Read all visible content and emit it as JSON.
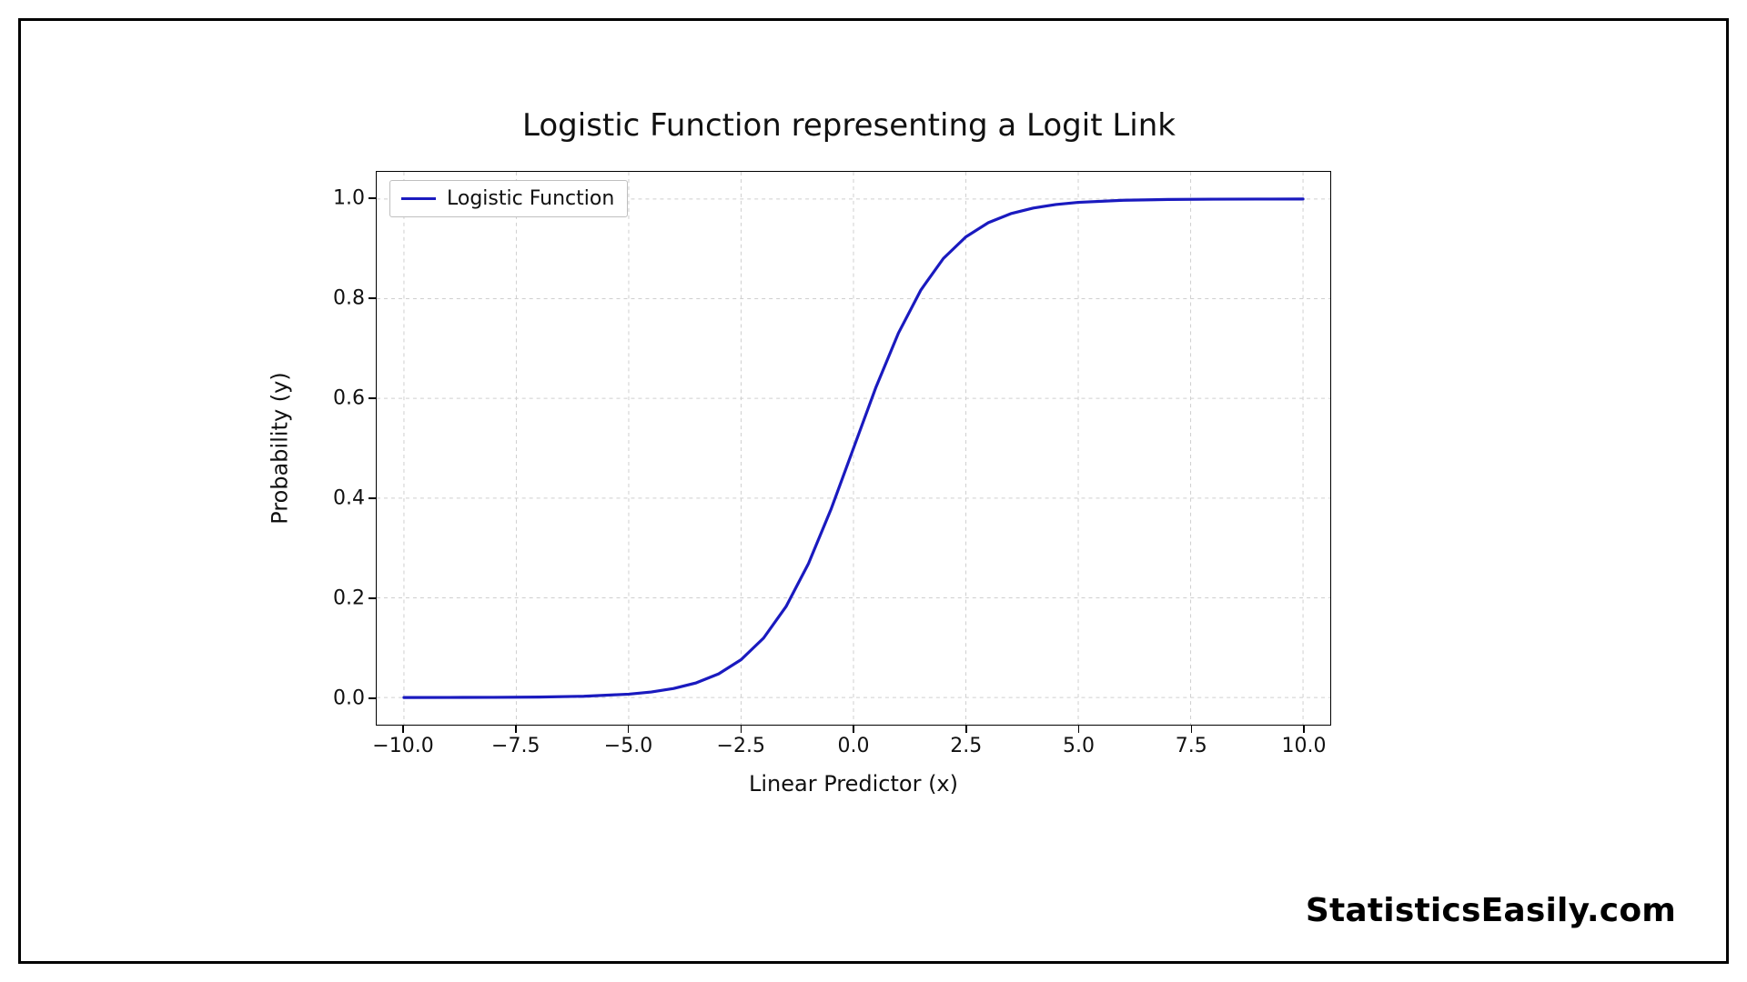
{
  "chart_data": {
    "type": "line",
    "title": "Logistic Function representing a Logit Link",
    "xlabel": "Linear Predictor (x)",
    "ylabel": "Probability (y)",
    "xlim": [
      -10,
      10
    ],
    "ylim": [
      0,
      1
    ],
    "x_ticks": [
      "−10.0",
      "−7.5",
      "−5.0",
      "−2.5",
      "0.0",
      "2.5",
      "5.0",
      "7.5",
      "10.0"
    ],
    "x_tick_values": [
      -10,
      -7.5,
      -5,
      -2.5,
      0,
      2.5,
      5,
      7.5,
      10
    ],
    "y_ticks": [
      "0.0",
      "0.2",
      "0.4",
      "0.6",
      "0.8",
      "1.0"
    ],
    "y_tick_values": [
      0,
      0.2,
      0.4,
      0.6,
      0.8,
      1.0
    ],
    "series": [
      {
        "name": "Logistic Function",
        "function": "1/(1+exp(-x))",
        "x": [
          -10,
          -9,
          -8,
          -7,
          -6,
          -5,
          -4.5,
          -4,
          -3.5,
          -3,
          -2.5,
          -2,
          -1.5,
          -1,
          -0.5,
          0,
          0.5,
          1,
          1.5,
          2,
          2.5,
          3,
          3.5,
          4,
          4.5,
          5,
          6,
          7,
          8,
          9,
          10
        ],
        "y": [
          0.0,
          0.0001,
          0.0003,
          0.0009,
          0.0025,
          0.0067,
          0.011,
          0.018,
          0.0293,
          0.0474,
          0.0759,
          0.1192,
          0.1824,
          0.2689,
          0.3775,
          0.5,
          0.6225,
          0.7311,
          0.8176,
          0.8808,
          0.9241,
          0.9526,
          0.9707,
          0.982,
          0.989,
          0.9933,
          0.9975,
          0.9991,
          0.9997,
          0.9999,
          1.0
        ]
      }
    ],
    "legend_position": "upper left",
    "grid": true,
    "line_color": "#1a1abf"
  },
  "watermark": "StatisticsEasily.com"
}
